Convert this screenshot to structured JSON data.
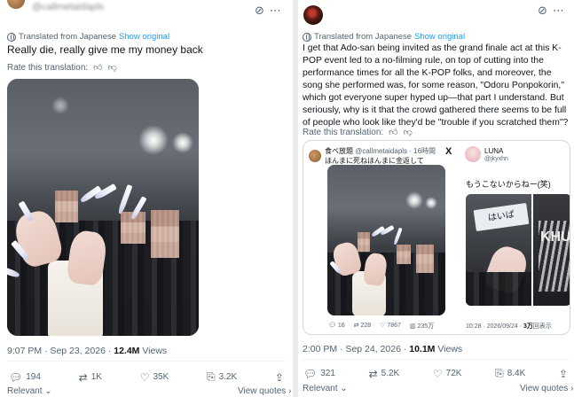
{
  "left": {
    "handle": "@callmetaidapls",
    "top_icons": [
      "grok-icon",
      "more-icon"
    ],
    "translated_label": "Translated from Japanese",
    "show_original": "Show original",
    "text": "Really die, really give me my money back",
    "rate_label": "Rate this translation:",
    "timestamp": "9:07 PM · Sep 23, 2026 ·",
    "views_count": "12.4M",
    "views_label": "Views",
    "actions": {
      "replies": "194",
      "reposts": "1K",
      "likes": "35K",
      "bookmarks": "3.2K"
    },
    "footer_left": "Relevant",
    "footer_right": "View quotes"
  },
  "right": {
    "translated_label": "Translated from Japanese",
    "show_original": "Show original",
    "text": "I get that Ado-san being invited as the grand finale act at this K-POP event led to a no-filming rule, on top of cutting into the performance times for all the K-POP folks, and moreover, the song she performed was, for some reason, \"Odoru Ponpokorin,\" which got everyone super hyped up—that part I understand. But seriously, why is it that the crowd gathered there seems to be full of people who look like they'd be \"trouble if you scratched them\"?",
    "rate_label": "Rate this translation:",
    "embed_left": {
      "name": "食べ放題",
      "handle": "@callmetaidapls · 16時間",
      "text": "ほんまに死ねほんまに金返して",
      "actions": {
        "replies": "16",
        "reposts": "228",
        "likes": "7867",
        "views": "235万"
      }
    },
    "embed_right": {
      "name": "LUNA",
      "handle": "@jkyxhn",
      "text": "もうこないからねー(笑)",
      "timestamp": "10:28 · 2026/09/24 ·",
      "views": "3万",
      "views_label": "回表示",
      "banner_left": "はいぱ",
      "banner_right": "KHU"
    },
    "timestamp": "2:00 PM · Sep 24, 2026 ·",
    "views_count": "10.1M",
    "views_label": "Views",
    "actions": {
      "replies": "321",
      "reposts": "5.2K",
      "likes": "72K",
      "bookmarks": "8.4K"
    },
    "footer_left": "Relevant",
    "footer_right": "View quotes"
  }
}
